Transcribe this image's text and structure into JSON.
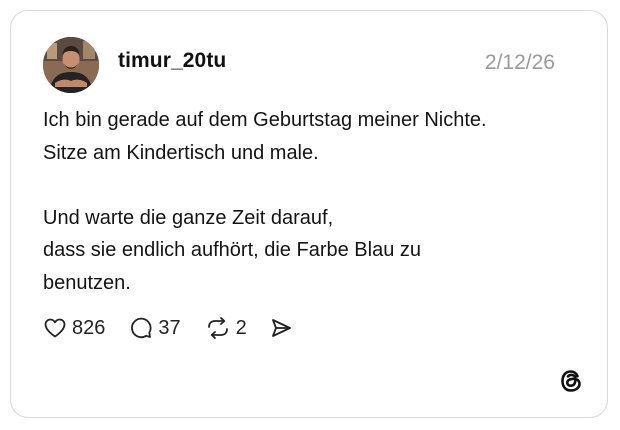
{
  "post": {
    "username": "timur_20tu",
    "timestamp": "2/12/26",
    "text": "Ich bin gerade auf dem Geburtstag meiner Nichte.\nSitze am Kindertisch und male.\n\nUnd warte die ganze Zeit darauf,\ndass sie endlich aufhört, die Farbe Blau zu\nbenutzen.",
    "likes": "826",
    "replies": "37",
    "reposts": "2"
  },
  "icons": {
    "like": "heart-icon",
    "reply": "speech-bubble-icon",
    "repost": "repost-arrows-icon",
    "share": "send-icon",
    "brand": "threads-logo-icon"
  },
  "colors": {
    "text": "#141414",
    "timestamp": "#9a9a9a",
    "border": "#d9d9d9"
  }
}
